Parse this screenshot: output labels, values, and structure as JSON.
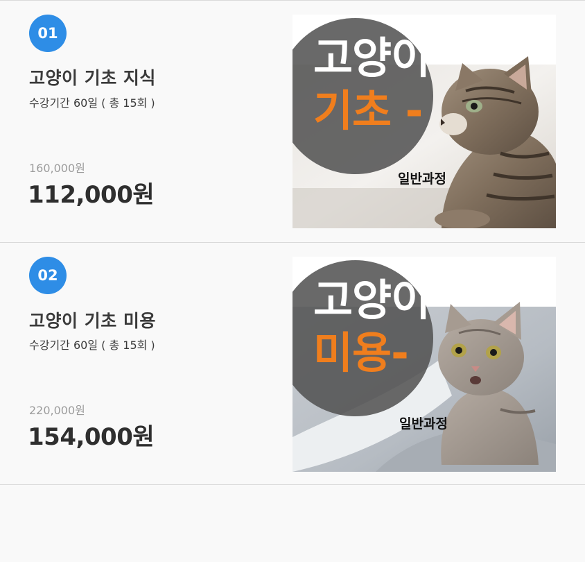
{
  "courses": [
    {
      "number": "01",
      "title": "고양이 기초 지식",
      "period": "수강기간 60일 ( 총 15회 )",
      "original_price": "160,000원",
      "sale_price": "112,000원",
      "thumbnail": {
        "line1": "고양이",
        "line2": "기초 -",
        "sub": "일반과정"
      }
    },
    {
      "number": "02",
      "title": "고양이 기초 미용",
      "period": "수강기간 60일 ( 총 15회 )",
      "original_price": "220,000원",
      "sale_price": "154,000원",
      "thumbnail": {
        "line1": "고양이",
        "line2": "미용-",
        "sub": "일반과정"
      }
    }
  ],
  "colors": {
    "badge": "#2e8de6",
    "accent_orange": "#f07e1d",
    "circle_overlay": "#505050",
    "background": "#f9f9f9"
  }
}
